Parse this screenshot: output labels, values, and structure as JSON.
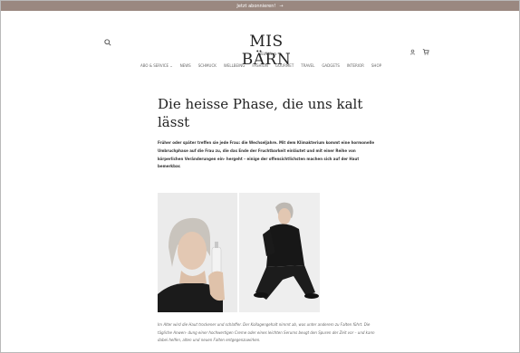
{
  "announcement": {
    "text": "Jetzt abonnieren!",
    "arrow": "→"
  },
  "header": {
    "logo_main": "MIS BÄRN",
    "logo_sub": "Edition"
  },
  "nav": {
    "items": [
      "ABO & SERVICE ⌄",
      "NEWS",
      "SCHMUCK",
      "WELLBEING",
      "FASHION",
      "GOURMET",
      "TRAVEL",
      "GADGETS",
      "INTERIOR",
      "SHOP"
    ]
  },
  "article": {
    "title": "Die heisse Phase, die uns kalt lässt",
    "intro": "Früher oder später treffen sie jede Frau: die Wechseljahre. Mit dem Klimakterium kommt eine hormonelle Umbruchphase auf die Frau zu, die das Ende der Fruchtbarkeit einläutet und mit einer Reihe von körperlichen Veränderungen ein- hergeht – einige der offensichtlichsten machen sich auf der Haut bemerkbar.",
    "caption": "Im Alter wird die Haut trockener und schlaffer. Der Kollagengehalt nimmt ab, was unter anderem zu Falten führt. Die tägliche Anwen- dung einer hochwertigen Creme oder eines leichten Serums beugt den Spuren der Zeit vor – und kann dabei helfen, alten und neuen Falten entgegenzuwirken."
  },
  "colors": {
    "announcement_bg": "#9a8880",
    "text": "#222222"
  },
  "icons": {
    "search": "search-icon",
    "account": "user-icon",
    "cart": "cart-icon"
  }
}
